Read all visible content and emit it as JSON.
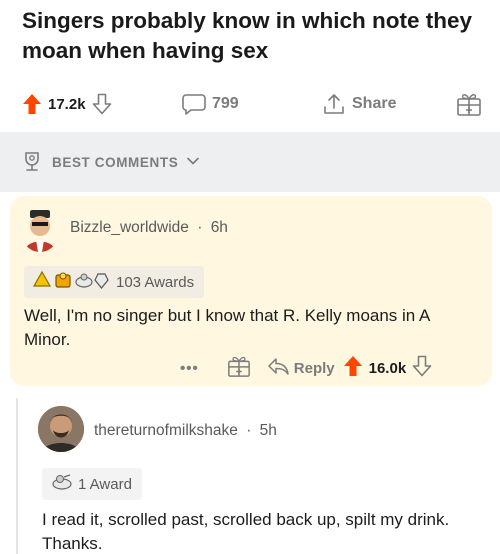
{
  "post": {
    "title": "Singers probably know in which note they moan when having sex",
    "upvotes": "17.2k",
    "comments_count": "799",
    "share_label": "Share"
  },
  "sort": {
    "label": "BEST COMMENTS"
  },
  "comments": [
    {
      "username": "Bizzle_worldwide",
      "age": "6h",
      "awards_label": "103 Awards",
      "text": "Well, I'm no singer but I know that R. Kelly moans in A Minor.",
      "more_label": "•••",
      "reply_label": "Reply",
      "votes": "16.0k"
    },
    {
      "username": "thereturnofmilkshake",
      "age": "5h",
      "awards_label": "1 Award",
      "text": "I read it, scrolled past, scrolled back up, spilt my drink. Thanks."
    }
  ],
  "colors": {
    "upvote": "#ff4500",
    "muted": "#7c7c7c",
    "sort_bar_bg": "#edeff1",
    "highlight_bg": "#fff7e0"
  },
  "icons": [
    "upvote-arrow-icon",
    "downvote-arrow-icon",
    "comment-bubble-icon",
    "share-icon",
    "gift-icon",
    "trophy-icon",
    "chevron-down-icon",
    "reply-arrow-icon"
  ]
}
